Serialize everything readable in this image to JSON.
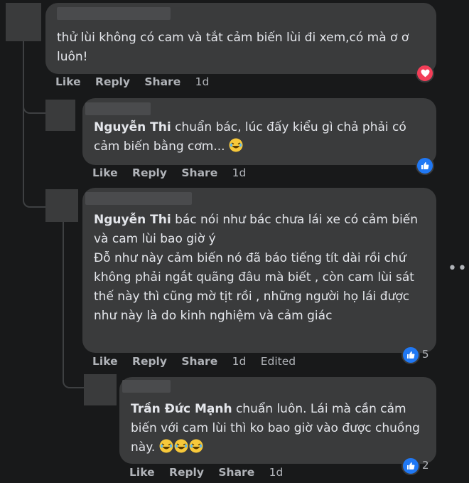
{
  "comments": [
    {
      "text": "thử lùi không có cam và tắt cảm biến lùi đi xem,có mà ơ ơ luôn!",
      "actions": {
        "like": "Like",
        "reply": "Reply",
        "share": "Share",
        "time": "1d"
      }
    },
    {
      "author": "Nguyễn Thi",
      "text": "chuẩn bác, lúc đấy kiểu gì chả phải có cảm biến bằng cơm...",
      "actions": {
        "like": "Like",
        "reply": "Reply",
        "share": "Share",
        "time": "1d"
      }
    },
    {
      "author": "Nguyễn Thi",
      "text": "bác nói như bác chưa lái xe có cảm biến và cam lùi bao giờ ý\nĐỗ như này cảm biến nó đã báo tiếng tít dài rồi chứ không phải ngắt quãng đâu mà biết , còn cam lùi sát thế này thì cũng mờ tịt rồi , những người họ lái được như này là do kinh nghiệm và cảm giác",
      "actions": {
        "like": "Like",
        "reply": "Reply",
        "share": "Share",
        "time": "1d",
        "edited": "Edited"
      },
      "reaction_count": "5"
    },
    {
      "author": "Trần Đức Mạnh",
      "text": "chuẩn luôn. Lái mà cần cảm biến với cam lùi thì ko bao giờ vào được chuồng này.",
      "actions": {
        "like": "Like",
        "reply": "Reply",
        "share": "Share",
        "time": "1d"
      },
      "reaction_count": "2"
    }
  ],
  "icons": {
    "more": "more-horizontal-icon",
    "heart": "heart-reaction-icon",
    "like": "like-reaction-icon",
    "laugh": "laughing-emoji-icon"
  },
  "colors": {
    "background": "#18191a",
    "bubble": "#3a3b3c",
    "text": "#e4e6eb",
    "secondary": "#b0b3b8",
    "like_blue": "#2078f4",
    "heart_red": "#f33e58"
  }
}
